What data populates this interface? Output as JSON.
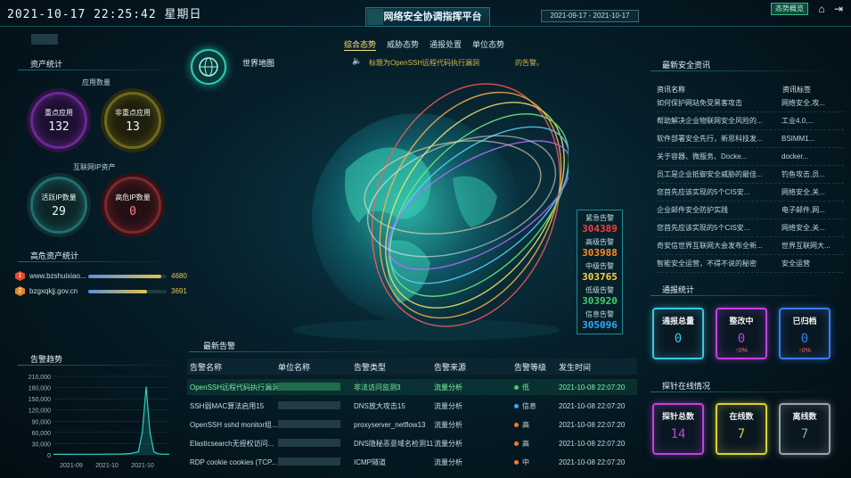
{
  "header": {
    "datetime": "2021-10-17 22:25:42 星期日",
    "title": "市网络安全协调指挥平台",
    "date_range": "2021-09-17 - 2021-10-17",
    "status_button": "态势概览"
  },
  "nav_tabs": [
    "综合态势",
    "威胁态势",
    "通报处置",
    "单位态势"
  ],
  "world_map_label": "世界地图",
  "ticker": {
    "text": "标题为OpenSSH远程代码执行漏洞",
    "suffix": "的告警。"
  },
  "asset_stats": {
    "title": "资产统计",
    "app_count_label": "应用数量",
    "key_apps": {
      "label": "重点应用",
      "value": "132"
    },
    "non_key_apps": {
      "label": "非重点应用",
      "value": "13"
    },
    "internet_ip_label": "互联网IP资产",
    "active_ip": {
      "label": "活跃IP数量",
      "value": "29"
    },
    "risk_ip": {
      "label": "高危IP数量",
      "value": "0"
    }
  },
  "high_risk": {
    "title": "高危资产统计",
    "items": [
      {
        "rank": "1",
        "name": "www.bzshuixiao...",
        "value": "4680",
        "fraction": 0.93
      },
      {
        "rank": "2",
        "name": "bzgxqkjj.gov.cn",
        "value": "3691",
        "fraction": 0.75
      }
    ]
  },
  "trend": {
    "title": "告警趋势"
  },
  "chart_data": {
    "type": "line",
    "title": "告警趋势",
    "xlabel": "",
    "ylabel": "",
    "x_ticks": [
      "2021-09",
      "2021-10",
      "2021-10"
    ],
    "y_ticks": [
      "0",
      "30,000",
      "60,000",
      "90,000",
      "120,000",
      "150,000",
      "180,000",
      "210,000"
    ],
    "ylim": [
      0,
      210000
    ],
    "grid": true,
    "series": [
      {
        "x": [
          0,
          2,
          4,
          6,
          8,
          10,
          12,
          14,
          16,
          18,
          20,
          22,
          23,
          24,
          25,
          26,
          27,
          28,
          30
        ],
        "values": [
          1500,
          1500,
          1500,
          1600,
          1600,
          1700,
          1700,
          1800,
          2000,
          2500,
          3500,
          8000,
          60000,
          182000,
          60000,
          8000,
          3000,
          2000,
          1500
        ]
      }
    ]
  },
  "alarm_levels": {
    "items": [
      {
        "label": "紧急告警",
        "value": "304389",
        "color": "#ff3b3b"
      },
      {
        "label": "高级告警",
        "value": "303988",
        "color": "#ff8a25"
      },
      {
        "label": "中级告警",
        "value": "303765",
        "color": "#ffd23a"
      },
      {
        "label": "低级告警",
        "value": "303920",
        "color": "#3fd06a"
      },
      {
        "label": "信息告警",
        "value": "305096",
        "color": "#36a6ff"
      }
    ]
  },
  "latest_alarms": {
    "title": "最新告警",
    "columns": [
      "告警名称",
      "单位名称",
      "告警类型",
      "告警来源",
      "告警等级",
      "发生时间"
    ],
    "rows": [
      {
        "name": "OpenSSH远程代码执行漏洞",
        "type": "非法访问监测3",
        "source": "流量分析",
        "level": "低",
        "level_color": "#3fd06a",
        "time": "2021-10-08 22:07:20",
        "highlight": true
      },
      {
        "name": "SSH弱MAC算法启用15",
        "type": "DNS放大攻击15",
        "source": "流量分析",
        "level": "信息",
        "level_color": "#36a6ff",
        "time": "2021-10-08 22:07:20",
        "highlight": false
      },
      {
        "name": "OpenSSH sshd monitor组...",
        "type": "proxyserver_netflow13",
        "source": "流量分析",
        "level": "高",
        "level_color": "#ff7a25",
        "time": "2021-10-08 22:07:20",
        "highlight": false
      },
      {
        "name": "Elasticsearch无授权访问...",
        "type": "DNS隐秘恶意域名检测11",
        "source": "流量分析",
        "level": "高",
        "level_color": "#ff7a25",
        "time": "2021-10-08 22:07:20",
        "highlight": false
      },
      {
        "name": "RDP cookie cookies (TCP...",
        "type": "ICMP隧道",
        "source": "流量分析",
        "level": "中",
        "level_color": "#ff7a25",
        "time": "2021-10-08 22:07:20",
        "highlight": false
      }
    ]
  },
  "news": {
    "title": "最新安全资讯",
    "col_title": "资讯名称",
    "col_tag": "资讯标签",
    "rows": [
      {
        "title": "如何保护网站免受黑客攻击",
        "tag": "网络安全,攻..."
      },
      {
        "title": "帮助解决企业物联网安全风险的...",
        "tag": "工业4.0,..."
      },
      {
        "title": "软件部署安全先行，新思科技发...",
        "tag": "BSIMM1..."
      },
      {
        "title": "关于容器、微服务、Docke...",
        "tag": "docker..."
      },
      {
        "title": "员工是企业抵御安全威胁的最佳...",
        "tag": "钓鱼攻击,员..."
      },
      {
        "title": "您首先应该实现的5个CIS安...",
        "tag": "网络安全,关..."
      },
      {
        "title": "企业邮件安全防护实践",
        "tag": "电子邮件,网..."
      },
      {
        "title": "您首先应该实现的5个CIS安...",
        "tag": "网络安全,关..."
      },
      {
        "title": "奇安信世界互联网大会发布全新...",
        "tag": "世界互联网大..."
      },
      {
        "title": "智能安全运营，不得不说的秘密",
        "tag": "安全运营"
      }
    ]
  },
  "notify_stats": {
    "title": "通报统计",
    "tiles": [
      {
        "label": "通报总量",
        "value": "0",
        "pct": "",
        "color": "#3ec7e0"
      },
      {
        "label": "整改中",
        "value": "0",
        "pct": "↑0%",
        "color": "#c243e0"
      },
      {
        "label": "已归档",
        "value": "0",
        "pct": "↑0%",
        "color": "#3b7de8"
      }
    ]
  },
  "probe_stats": {
    "title": "探针在线情况",
    "tiles": [
      {
        "label": "探针总数",
        "value": "14",
        "color": "#c243e0"
      },
      {
        "label": "在线数",
        "value": "7",
        "color": "#d8d23a"
      },
      {
        "label": "离线数",
        "value": "7",
        "color": "#9aa3a8"
      }
    ]
  }
}
